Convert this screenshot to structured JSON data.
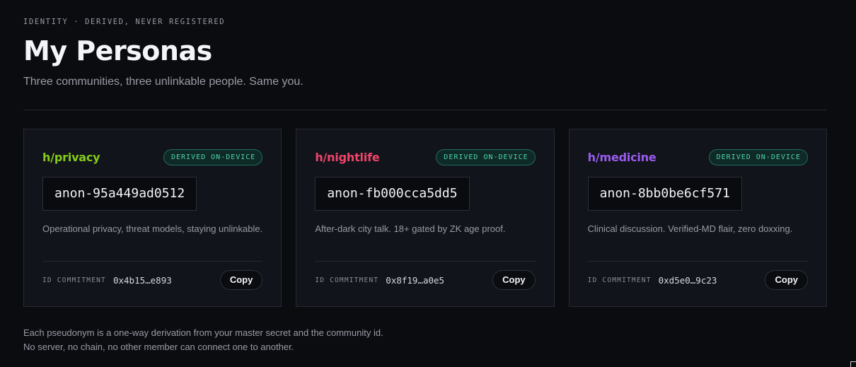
{
  "header": {
    "eyebrow": "IDENTITY · DERIVED, NEVER REGISTERED",
    "title": "My Personas",
    "subtitle": "Three communities, three unlinkable people. Same you."
  },
  "colors": {
    "privacy": "#84cc16",
    "nightlife": "#f0446a",
    "medicine": "#9a5cf0",
    "badge": "#4fd1b0"
  },
  "personas": [
    {
      "community": "h/privacy",
      "badge": "DERIVED ON-DEVICE",
      "handle": "anon-95a449ad0512",
      "description": "Operational privacy, threat models, staying unlinkable.",
      "commitment_label": "ID COMMITMENT",
      "commitment_value": "0x4b15…e893",
      "copy_label": "Copy"
    },
    {
      "community": "h/nightlife",
      "badge": "DERIVED ON-DEVICE",
      "handle": "anon-fb000cca5dd5",
      "description": "After-dark city talk. 18+ gated by ZK age proof.",
      "commitment_label": "ID COMMITMENT",
      "commitment_value": "0x8f19…a0e5",
      "copy_label": "Copy"
    },
    {
      "community": "h/medicine",
      "badge": "DERIVED ON-DEVICE",
      "handle": "anon-8bb0be6cf571",
      "description": "Clinical discussion. Verified-MD flair, zero doxxing.",
      "commitment_label": "ID COMMITMENT",
      "commitment_value": "0xd5e0…9c23",
      "copy_label": "Copy"
    }
  ],
  "footnote": {
    "line1": "Each pseudonym is a one-way derivation from your master secret and the community id.",
    "line2": "No server, no chain, no other member can connect one to another."
  }
}
